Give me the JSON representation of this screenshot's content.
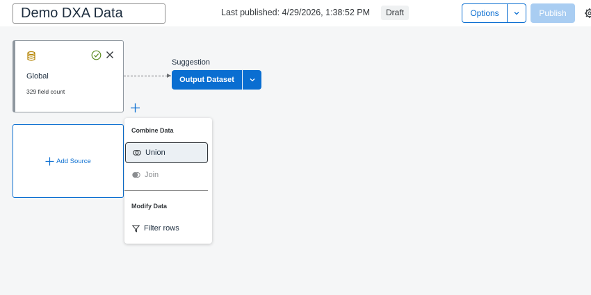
{
  "header": {
    "title": "Demo DXA Data",
    "last_published": "Last published: 4/29/2026, 1:38:52 PM",
    "status": "Draft",
    "options_label": "Options",
    "publish_label": "Publish"
  },
  "source": {
    "name": "Global",
    "field_count": "329 field count"
  },
  "suggestion": {
    "label": "Suggestion",
    "button_label": "Output Dataset"
  },
  "add_source": {
    "label": "Add Source"
  },
  "menu": {
    "combine_header": "Combine Data",
    "union_label": "Union",
    "join_label": "Join",
    "modify_header": "Modify Data",
    "filter_label": "Filter rows"
  },
  "colors": {
    "brand": "#0a6ed1",
    "publish_disabled": "#a9cdf2",
    "success": "#5b8b1f",
    "source_icon": "#b38200"
  }
}
